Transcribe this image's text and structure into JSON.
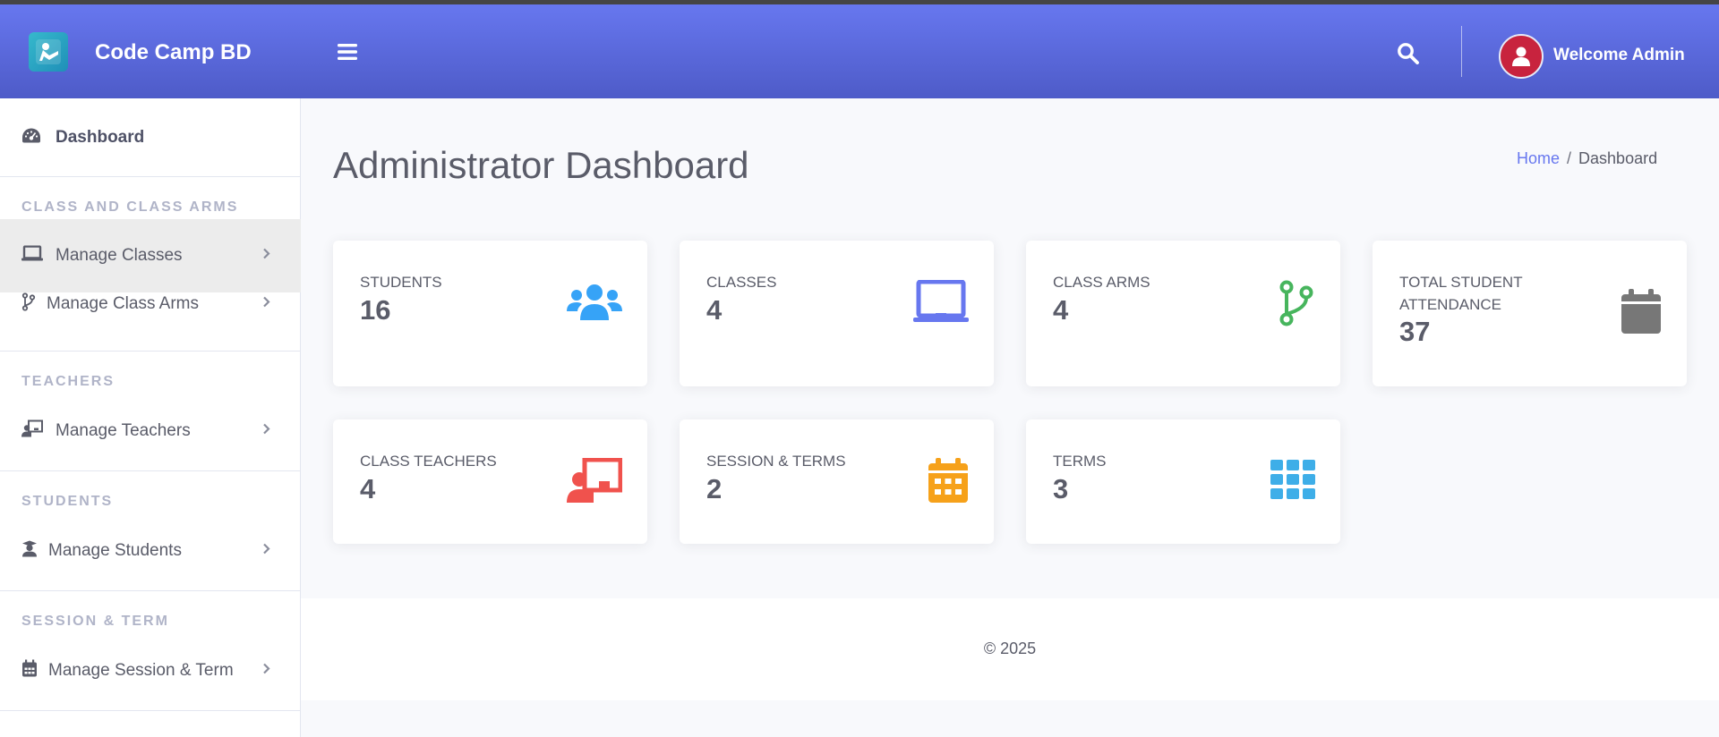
{
  "header": {
    "brand": "Code Camp BD",
    "welcome": "Welcome Admin",
    "icons": {
      "logo": "graduate-logo-icon",
      "menu": "hamburger-icon",
      "search": "search-icon",
      "avatar": "user-icon"
    }
  },
  "sidebar": {
    "dashboard": "Dashboard",
    "sections": [
      {
        "heading": "CLASS AND CLASS ARMS",
        "items": [
          "Manage Classes",
          "Manage Class Arms"
        ]
      },
      {
        "heading": "TEACHERS",
        "items": [
          "Manage Teachers"
        ]
      },
      {
        "heading": "STUDENTS",
        "items": [
          "Manage Students"
        ]
      },
      {
        "heading": "SESSION & TERM",
        "items": [
          "Manage Session & Term"
        ]
      }
    ],
    "active_item": "Manage Classes"
  },
  "main": {
    "title": "Administrator Dashboard",
    "breadcrumb": {
      "home": "Home",
      "separator": "/",
      "current": "Dashboard"
    },
    "cards": [
      {
        "title": "STUDENTS",
        "value": "16",
        "icon": "users-icon",
        "color": "#36a3f7"
      },
      {
        "title": "CLASSES",
        "value": "4",
        "icon": "laptop-icon",
        "color": "#6777ef"
      },
      {
        "title": "CLASS ARMS",
        "value": "4",
        "icon": "code-branch-icon",
        "color": "#47b55d"
      },
      {
        "title": "TOTAL STUDENT ATTENDANCE",
        "value": "37",
        "icon": "calendar-icon",
        "color": "#777777"
      },
      {
        "title": "CLASS TEACHERS",
        "value": "4",
        "icon": "chalkboard-teacher-icon",
        "color": "#f0524d"
      },
      {
        "title": "SESSION & TERMS",
        "value": "2",
        "icon": "calendar-alt-icon",
        "color": "#f6a11a"
      },
      {
        "title": "TERMS",
        "value": "3",
        "icon": "th-icon",
        "color": "#3eaee8"
      }
    ]
  },
  "footer": {
    "copyright": "© 2025"
  },
  "colors": {
    "primary": "#6777ef",
    "sidebar_active": "#ececec",
    "text": "#5a5c69",
    "muted_heading": "#b0b4c8"
  }
}
